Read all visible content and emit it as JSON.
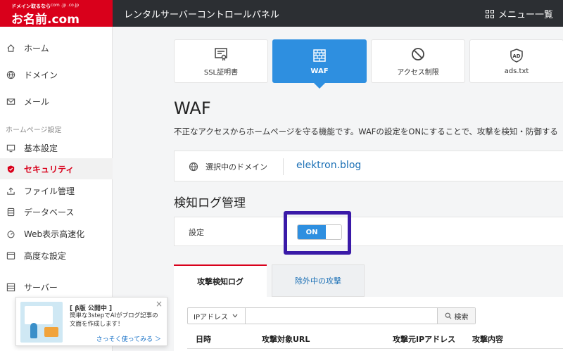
{
  "header": {
    "logo_tagline": "ドメイン取るなら",
    "logo_domains": ".com .jp .co.jp",
    "logo_text": "お名前.com",
    "title": "レンタルサーバーコントロールパネル",
    "menu_all": "メニュー一覧"
  },
  "sidebar": {
    "section_label": "ホームページ設定",
    "items": [
      {
        "label": "ホーム",
        "icon": "home-icon"
      },
      {
        "label": "ドメイン",
        "icon": "globe-icon"
      },
      {
        "label": "メール",
        "icon": "mail-icon"
      },
      {
        "label": "基本設定",
        "icon": "monitor-icon"
      },
      {
        "label": "セキュリティ",
        "icon": "shield-icon",
        "active": true
      },
      {
        "label": "ファイル管理",
        "icon": "upload-icon"
      },
      {
        "label": "データベース",
        "icon": "database-icon"
      },
      {
        "label": "Web表示高速化",
        "icon": "speed-icon"
      },
      {
        "label": "高度な設定",
        "icon": "window-icon"
      },
      {
        "label": "サーバー",
        "icon": "server-icon"
      }
    ]
  },
  "promo": {
    "title": "[ β版 公開中 ]",
    "body": "簡単な3stepでAIがブログ記事の文面を作成します！",
    "link": "さっそく使ってみる ＞",
    "close": "×"
  },
  "tiles": [
    {
      "label": "SSL証明書",
      "icon": "certificate-icon"
    },
    {
      "label": "WAF",
      "icon": "firewall-icon",
      "active": true
    },
    {
      "label": "アクセス制限",
      "icon": "prohibit-icon"
    },
    {
      "label": "ads.txt",
      "icon": "ad-shield-icon"
    }
  ],
  "page": {
    "title": "WAF",
    "description": "不正なアクセスからホームページを守る機能です。WAFの設定をONにすることで、攻撃を検知・防御する"
  },
  "domain": {
    "label": "選択中のドメイン",
    "value": "elektron.blog"
  },
  "log_section": {
    "title": "検知ログ管理",
    "setting_label": "設定",
    "toggle_state": "ON"
  },
  "tabs": [
    {
      "label": "攻撃検知ログ",
      "active": true
    },
    {
      "label": "除外中の攻撃",
      "active": false
    }
  ],
  "filter": {
    "select_value": "IPアドレス",
    "input_value": "",
    "search_label": "検索"
  },
  "table": {
    "columns": [
      "日時",
      "攻撃対象URL",
      "攻撃元IPアドレス",
      "攻撃内容"
    ]
  },
  "colors": {
    "brand_red": "#d9001b",
    "accent_blue": "#2e8fe0",
    "highlight": "#3a1aa8"
  }
}
